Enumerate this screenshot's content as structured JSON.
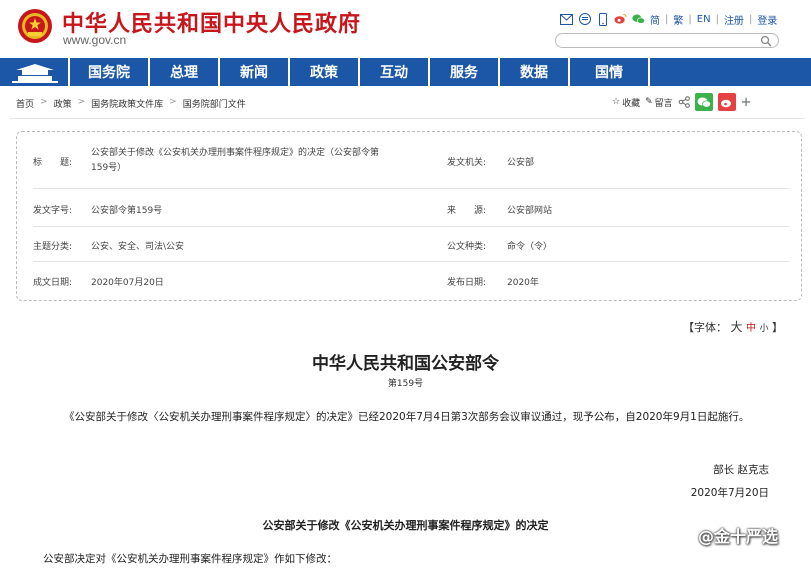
{
  "header": {
    "site_title": "中华人民共和国中央人民政府",
    "site_domain": "www.gov.cn",
    "links": [
      "简",
      "繁",
      "EN",
      "注册",
      "登录"
    ],
    "search_placeholder": ""
  },
  "nav": {
    "items": [
      "国务院",
      "总理",
      "新闻",
      "政策",
      "互动",
      "服务",
      "数据",
      "国情"
    ]
  },
  "breadcrumb": [
    "首页",
    "政策",
    "国务院政策文件库",
    "国务院部门文件"
  ],
  "tools": {
    "favorite": "收藏",
    "comment": "留言"
  },
  "doc_info": {
    "title_label": "标　　题:",
    "title_value": "公安部关于修改《公安机关办理刑事案件程序规定》的决定（公安部令第159号）",
    "issuer_label": "发文机关:",
    "issuer_value": "公安部",
    "doc_number_label": "发文字号:",
    "doc_number_value": "公安部令第159号",
    "source_label": "来　　源:",
    "source_value": "公安部网站",
    "topic_label": "主题分类:",
    "topic_value": "公安、安全、司法\\公安",
    "genre_label": "公文种类:",
    "genre_value": "命令（令）",
    "date_label": "成文日期:",
    "date_value": "2020年07月20日",
    "publish_label": "发布日期:",
    "publish_value": "2020年"
  },
  "font_size": {
    "prefix": "【字体：",
    "big": "大",
    "mid": "中",
    "small": "小",
    "suffix": "】"
  },
  "article": {
    "title": "中华人民共和国公安部令",
    "number": "第159号",
    "body": "《公安部关于修改〈公安机关办理刑事案件程序规定〉的决定》已经2020年7月4日第3次部务会议审议通过，现予公布，自2020年9月1日起施行。",
    "signer": "部长  赵克志",
    "sign_date": "2020年7月20日",
    "sub_title": "公安部关于修改《公安机关办理刑事案件程序规定》的决定",
    "body2": "公安部决定对《公安机关办理刑事案件程序规定》作如下修改："
  },
  "watermark": "@金十严选",
  "colors": {
    "brand_red": "#c8161d",
    "nav_blue": "#1b56a7"
  }
}
